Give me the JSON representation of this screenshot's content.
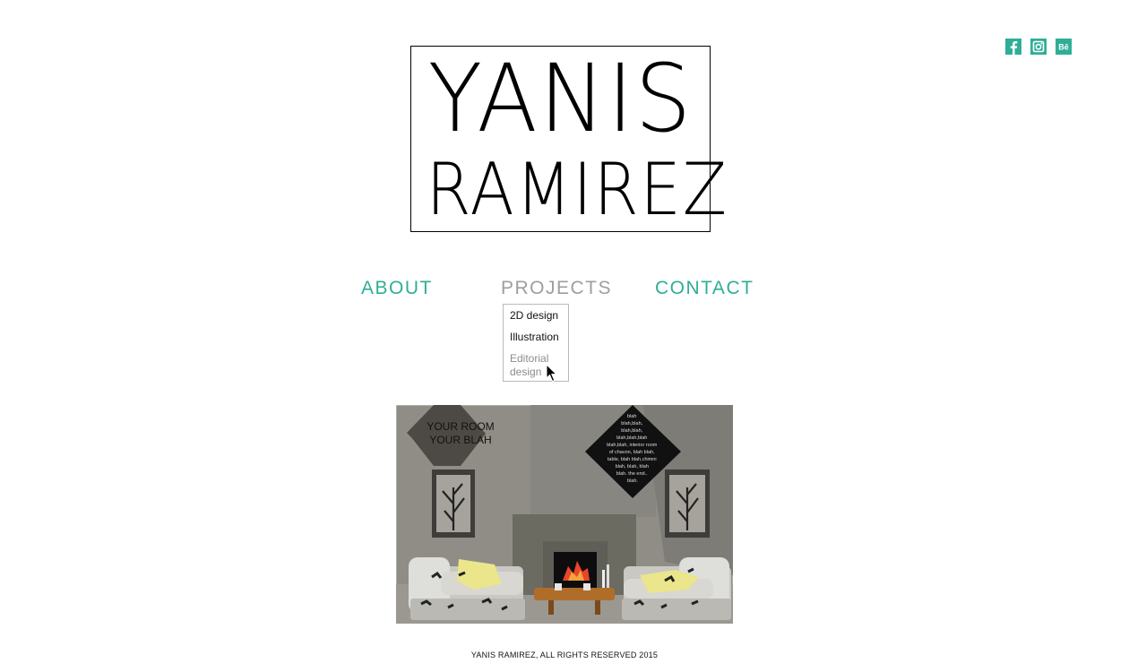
{
  "logo": {
    "line1": "YANIS",
    "line2": "RAMIREZ"
  },
  "social": [
    {
      "name": "facebook",
      "glyph": "f"
    },
    {
      "name": "instagram",
      "glyph": ""
    },
    {
      "name": "behance",
      "glyph": "Bē"
    }
  ],
  "nav": {
    "about": "ABOUT",
    "projects": "PROJECTS",
    "contact": "CONTACT"
  },
  "dropdown": {
    "items": [
      "2D design",
      "Illustration",
      "Editorial design"
    ]
  },
  "art": {
    "sign_left_line1": "YOUR ROOM",
    "sign_left_line2": "YOUR BLAH",
    "sign_right_lines": [
      "blah",
      "blah,blah,",
      "blah,blah,",
      "blah,blah,blah",
      "blah,blah, interior room",
      "of chavon, blah blah,",
      "table, blah blah,chimni",
      "blah, blah, blah",
      "blah. the end..",
      "blah."
    ]
  },
  "footer": {
    "text": "YANIS RAMIREZ,  ALL RIGHTS RESERVED 2015"
  },
  "colors": {
    "accent": "#2fae97",
    "muted": "#9e9e9e"
  }
}
